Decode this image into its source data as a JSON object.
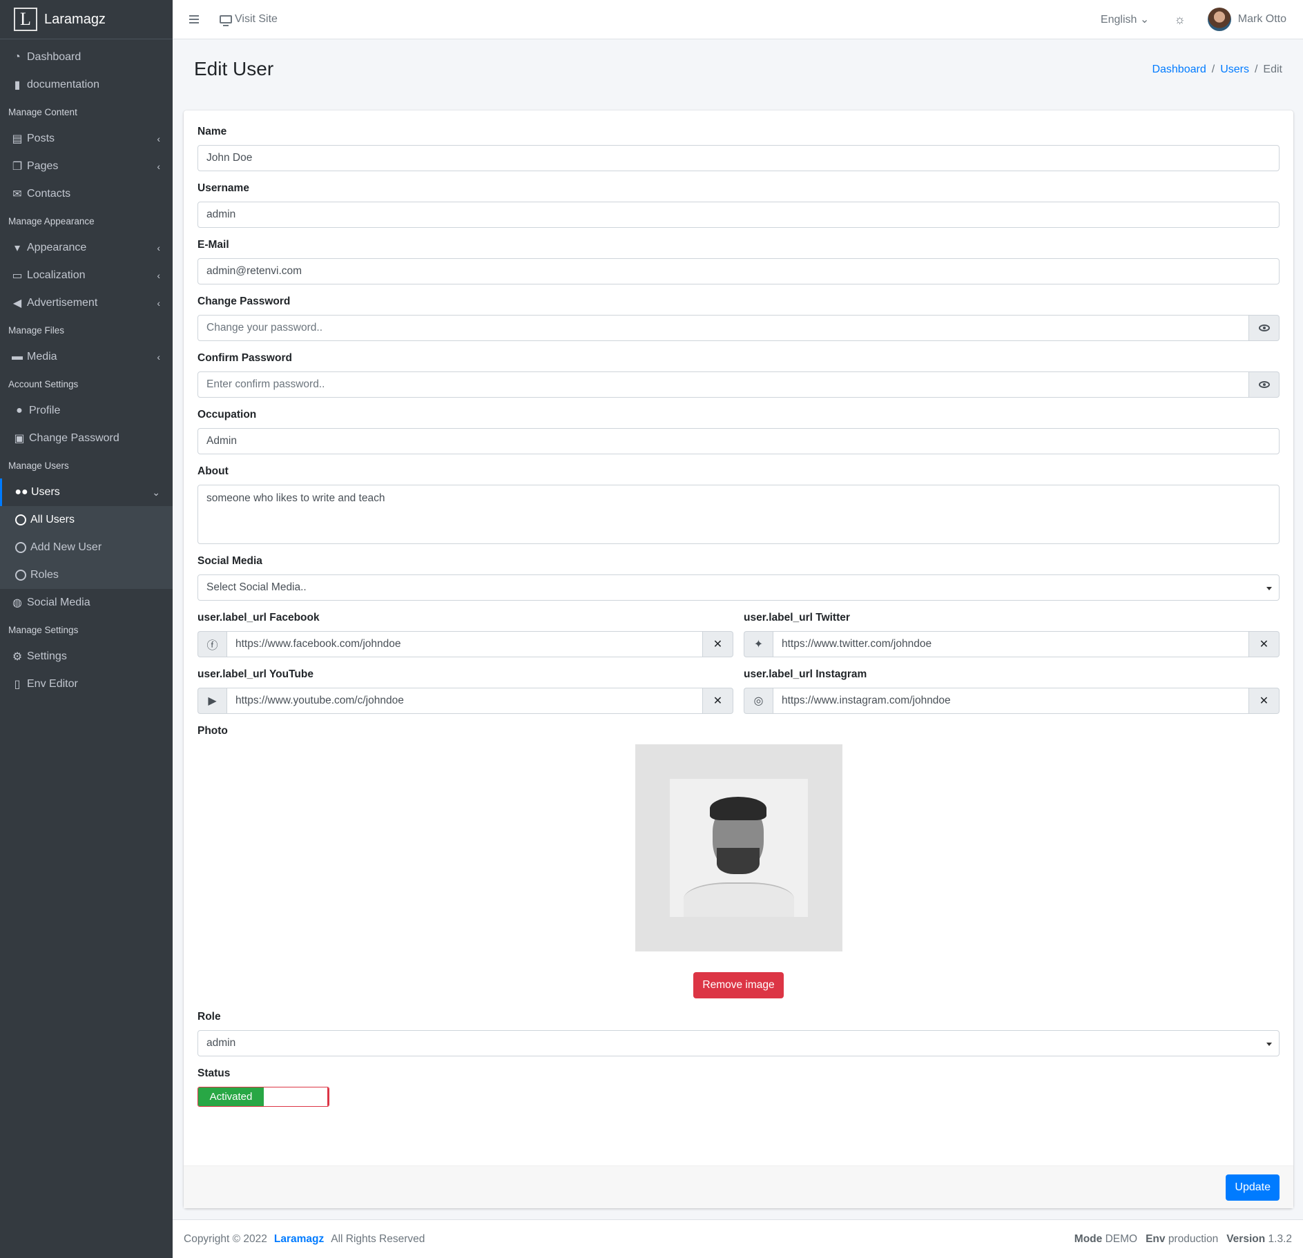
{
  "brand": {
    "logo_letter": "L",
    "name": "Laramagz"
  },
  "sidebar": {
    "items": [
      {
        "type": "item",
        "icon": "dashboard-icon",
        "label": "Dashboard"
      },
      {
        "type": "item",
        "icon": "book-icon",
        "label": "documentation"
      },
      {
        "type": "header",
        "label": "Manage Content"
      },
      {
        "type": "item",
        "icon": "posts-icon",
        "label": "Posts",
        "chevron": true
      },
      {
        "type": "item",
        "icon": "pages-icon",
        "label": "Pages",
        "chevron": true
      },
      {
        "type": "item",
        "icon": "envelope-icon",
        "label": "Contacts"
      },
      {
        "type": "header",
        "label": "Manage Appearance"
      },
      {
        "type": "item",
        "icon": "brush-icon",
        "label": "Appearance",
        "chevron": true
      },
      {
        "type": "item",
        "icon": "language-icon",
        "label": "Localization",
        "chevron": true
      },
      {
        "type": "item",
        "icon": "bullhorn-icon",
        "label": "Advertisement",
        "chevron": true
      },
      {
        "type": "header",
        "label": "Manage Files"
      },
      {
        "type": "item",
        "icon": "hdd-icon",
        "label": "Media",
        "chevron": true
      },
      {
        "type": "header",
        "label": "Account Settings"
      },
      {
        "type": "item",
        "icon": "user-icon",
        "label": "Profile"
      },
      {
        "type": "item",
        "icon": "lock-icon",
        "label": "Change Password"
      },
      {
        "type": "header",
        "label": "Manage Users"
      },
      {
        "type": "item",
        "icon": "users-icon",
        "label": "Users"
      },
      {
        "type": "item",
        "icon": "globe-icon",
        "label": "Social Media"
      },
      {
        "type": "header",
        "label": "Manage Settings"
      },
      {
        "type": "item",
        "icon": "cogs-icon",
        "label": "Settings"
      },
      {
        "type": "item",
        "icon": "file-icon",
        "label": "Env Editor"
      }
    ],
    "users_sub": [
      "All Users",
      "Add New User",
      "Roles"
    ]
  },
  "topbar": {
    "visit_site": "Visit Site",
    "language": "English",
    "user_name": "Mark Otto"
  },
  "page": {
    "title": "Edit User",
    "breadcrumb": [
      "Dashboard",
      "Users",
      "Edit"
    ]
  },
  "form": {
    "name_label": "Name",
    "name_value": "John Doe",
    "username_label": "Username",
    "username_value": "admin",
    "email_label": "E-Mail",
    "email_value": "admin@retenvi.com",
    "password_label": "Change Password",
    "password_placeholder": "Change your password..",
    "confirm_label": "Confirm Password",
    "confirm_placeholder": "Enter confirm password..",
    "occupation_label": "Occupation",
    "occupation_value": "Admin",
    "about_label": "About",
    "about_value": "someone who likes to write and teach",
    "social_label": "Social Media",
    "social_placeholder": "Select Social Media..",
    "facebook_label": "user.label_url Facebook",
    "facebook_value": "https://www.facebook.com/johndoe",
    "twitter_label": "user.label_url Twitter",
    "twitter_value": "https://www.twitter.com/johndoe",
    "youtube_label": "user.label_url YouTube",
    "youtube_value": "https://www.youtube.com/c/johndoe",
    "instagram_label": "user.label_url Instagram",
    "instagram_value": "https://www.instagram.com/johndoe",
    "photo_label": "Photo",
    "remove_image": "Remove image",
    "role_label": "Role",
    "role_value": "admin",
    "status_label": "Status",
    "status_value": "Activated",
    "update": "Update"
  },
  "footer": {
    "copyright": "Copyright © 2022",
    "brand": "Laramagz",
    "rights": "All Rights Reserved",
    "mode_label": "Mode",
    "mode_value": "DEMO",
    "env_label": "Env",
    "env_value": "production",
    "version_label": "Version",
    "version_value": "1.3.2"
  },
  "colors": {
    "sidebar": "#343a40",
    "primary": "#007bff",
    "danger": "#dc3545",
    "success": "#28a745"
  }
}
